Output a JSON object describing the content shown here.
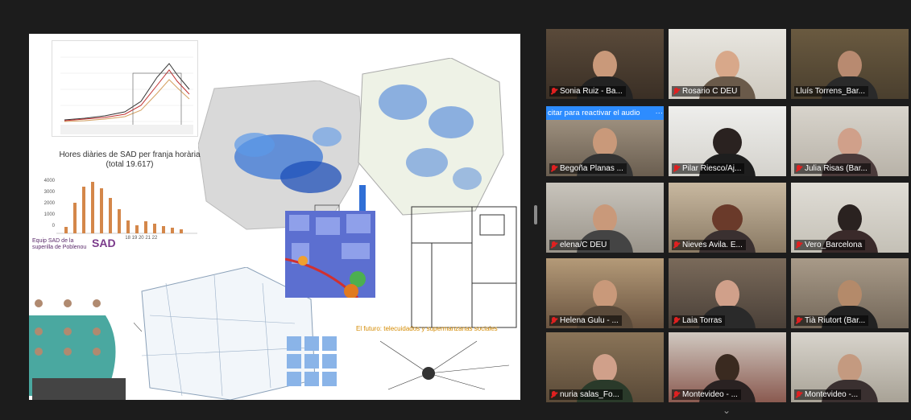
{
  "slide": {
    "histogram_title": "Hores diàries de SAD per franja horària (total 19.617)",
    "histogram_ticks": [
      "4000",
      "3000",
      "2000",
      "1000",
      "0"
    ],
    "histogram_xlabels": "7 8 9 10 11 12 13 14 15 16 17 18 19 20 21 22",
    "sad_logo": "SAD",
    "sad_title": "Equip SAD de la superilla de Poblenou",
    "future_title": "El futuro: telecuidados y supermanzanas sociales"
  },
  "participants": [
    {
      "name": "Sonia Ruiz - Ba...",
      "muted": true
    },
    {
      "name": "Rosario C DEU",
      "muted": true
    },
    {
      "name": "Lluís Torrens_Bar...",
      "muted": false,
      "active": true
    },
    {
      "name": "Begoña Planas ...",
      "muted": true,
      "banner": "citar para reactivar el audio"
    },
    {
      "name": "Pilar Riesco/Aj...",
      "muted": true
    },
    {
      "name": "Julia Risas (Bar...",
      "muted": true
    },
    {
      "name": "elena/C DEU",
      "muted": true
    },
    {
      "name": "Nieves Avila. E...",
      "muted": true
    },
    {
      "name": "Vero_Barcelona",
      "muted": true
    },
    {
      "name": "Helena Gulu - ...",
      "muted": true
    },
    {
      "name": "Laia Torras",
      "muted": true
    },
    {
      "name": "Tià Riutort (Bar...",
      "muted": true
    },
    {
      "name": "nuria salas_Fo...",
      "muted": true
    },
    {
      "name": "Montevideo - ...",
      "muted": true
    },
    {
      "name": "Montevideo -...",
      "muted": true
    }
  ],
  "banner_more": "···",
  "colors": {
    "active_outline": "#c9e06a",
    "banner": "#2d8cff",
    "muted_mic": "#e02020"
  },
  "icons": {
    "collapse": "chevron-down-icon"
  }
}
